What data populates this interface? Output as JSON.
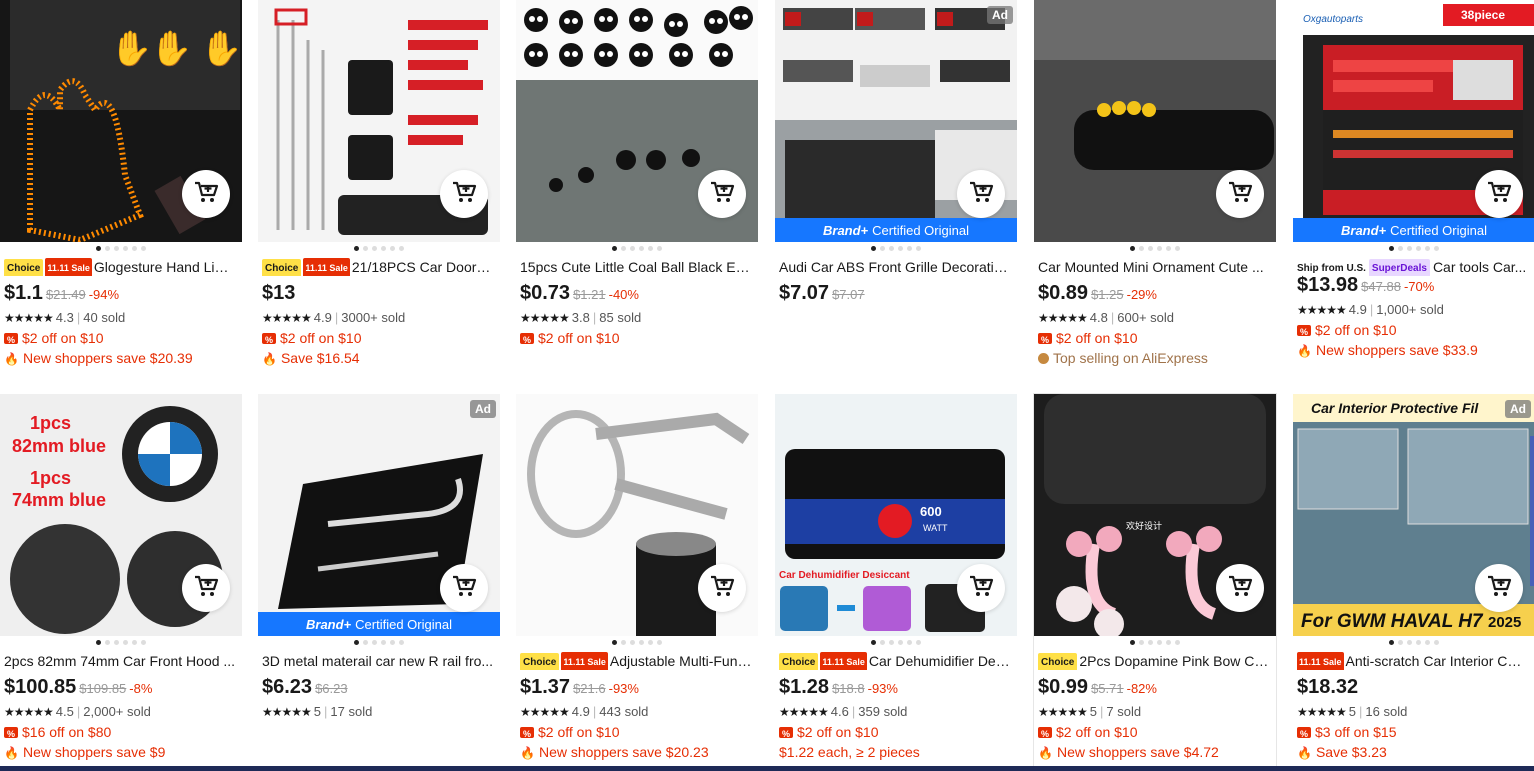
{
  "common": {
    "brand_plus": "Brand+",
    "certified": "Certified Original",
    "ad": "Ad"
  },
  "products": [
    {
      "col": 0,
      "row": 0,
      "tags": [
        "choice",
        "sale"
      ],
      "title": "Glogesture Hand Ligh...",
      "price": "$1.1",
      "orig": "$21.49",
      "disc": "-94%",
      "rating": "4.3",
      "sold": "40 sold",
      "promo1": "$2 off on $10",
      "promo2": "New shoppers save $20.39",
      "promo2_type": "fire",
      "img": "#1b1b1b",
      "accent": "#ff8a00",
      "brand": false,
      "ad": false
    },
    {
      "col": 1,
      "row": 0,
      "tags": [
        "choice",
        "sale"
      ],
      "title": "21/18PCS Car Door T...",
      "price": "$13",
      "orig": "",
      "disc": "",
      "rating": "4.9",
      "sold": "3000+ sold",
      "promo1": "$2 off on $10",
      "promo2": "Save $16.54",
      "promo2_type": "fire",
      "img": "#f4f4f4",
      "accent": "#d61f26",
      "brand": false,
      "ad": false
    },
    {
      "col": 2,
      "row": 0,
      "tags": [],
      "title": "15pcs Cute Little Coal Ball Black Elf...",
      "price": "$0.73",
      "orig": "$1.21",
      "disc": "-40%",
      "rating": "3.8",
      "sold": "85 sold",
      "promo1": "$2 off on $10",
      "promo2": "",
      "promo2_type": "",
      "img": "#6d7472",
      "accent": "#111111",
      "brand": false,
      "ad": false
    },
    {
      "col": 3,
      "row": 0,
      "tags": [],
      "title": "Audi Car ABS Front Grille Decoratio...",
      "price": "$7.07",
      "orig": "$7.07",
      "disc": "",
      "rating": "",
      "sold": "",
      "promo1": "",
      "promo2": "",
      "promo2_type": "",
      "img": "#d9d9d9",
      "accent": "#c11b1b",
      "brand": true,
      "ad": true
    },
    {
      "col": 4,
      "row": 0,
      "tags": [],
      "title": "Car Mounted Mini Ornament Cute ...",
      "price": "$0.89",
      "orig": "$1.25",
      "disc": "-29%",
      "rating": "4.8",
      "sold": "600+ sold",
      "promo1": "$2 off on $10",
      "promo2": "Top selling on AliExpress",
      "promo2_type": "top",
      "img": "#3b3b3b",
      "accent": "#f3c318",
      "brand": false,
      "ad": false
    },
    {
      "col": 5,
      "row": 0,
      "tags": [
        "us",
        "sd"
      ],
      "title": "Car tools Car...",
      "price": "$13.98",
      "orig": "$47.88",
      "disc": "-70%",
      "rating": "4.9",
      "sold": "1,000+ sold",
      "promo1": "$2 off on $10",
      "promo2": "New shoppers save $33.9",
      "promo2_type": "fire",
      "img": "#2b2b2b",
      "accent": "#e0242b",
      "brand": true,
      "ad": false,
      "badge": "38piece",
      "logo": "Oxgautoparts"
    },
    {
      "col": 0,
      "row": 1,
      "tags": [],
      "title": "2pcs 82mm 74mm Car Front Hood ...",
      "price": "$100.85",
      "orig": "$109.85",
      "disc": "-8%",
      "rating": "4.5",
      "sold": "2,000+ sold",
      "promo1": "$16 off on $80",
      "promo2": "New shoppers save $9",
      "promo2_type": "fire",
      "img": "#efefef",
      "accent": "#1e73be",
      "brand": false,
      "ad": false,
      "text1": "1pcs",
      "text2": "82mm blue",
      "text3": "1pcs",
      "text4": "74mm blue"
    },
    {
      "col": 1,
      "row": 1,
      "tags": [],
      "title": "3D metal materail car new R rail fro...",
      "price": "$6.23",
      "orig": "$6.23",
      "disc": "",
      "rating": "5",
      "sold": "17 sold",
      "promo1": "",
      "promo2": "",
      "promo2_type": "",
      "img": "#f2f2f2",
      "accent": "#0f0f0f",
      "brand": true,
      "ad": true
    },
    {
      "col": 2,
      "row": 1,
      "tags": [
        "choice",
        "sale"
      ],
      "title": "Adjustable Multi-Func...",
      "price": "$1.37",
      "orig": "$21.6",
      "disc": "-93%",
      "rating": "4.9",
      "sold": "443 sold",
      "promo1": "$2 off on $10",
      "promo2": "New shoppers save $20.23",
      "promo2_type": "fire",
      "img": "#f7f7f7",
      "accent": "#9a9a9a",
      "brand": false,
      "ad": false
    },
    {
      "col": 3,
      "row": 1,
      "tags": [
        "choice",
        "sale"
      ],
      "title": "Car Dehumidifier Desi...",
      "price": "$1.28",
      "orig": "$18.8",
      "disc": "-93%",
      "rating": "4.6",
      "sold": "359 sold",
      "promo1": "$2 off on $10",
      "promo2": "$1.22 each, ≥ 2 pieces",
      "promo2_type": "plain",
      "img": "#eef3f5",
      "accent": "#1b3d8f",
      "brand": false,
      "ad": false,
      "text1": "600",
      "text2": "WATT",
      "text3": "Car Dehumidifier Desiccant"
    },
    {
      "col": 4,
      "row": 1,
      "tags": [
        "choice"
      ],
      "title": "2Pcs Dopamine Pink Bow Ca...",
      "price": "$0.99",
      "orig": "$5.71",
      "disc": "-82%",
      "rating": "5",
      "sold": "7 sold",
      "promo1": "$2 off on $10",
      "promo2": "New shoppers save $4.72",
      "promo2_type": "fire",
      "img": "#1f1f1f",
      "accent": "#f2a9bd",
      "brand": false,
      "ad": false,
      "hover": true,
      "text1": "欢好设计"
    },
    {
      "col": 5,
      "row": 1,
      "tags": [
        "sale"
      ],
      "title": "Anti-scratch Car Interior Cen...",
      "price": "$18.32",
      "orig": "",
      "disc": "",
      "rating": "5",
      "sold": "16 sold",
      "promo1": "$3 off on $15",
      "promo2": "Save $3.23",
      "promo2_type": "fire",
      "img": "#5f7f8f",
      "accent": "#f6d04d",
      "brand": false,
      "ad": true,
      "text1": "Car Interior Protective Fil",
      "text2": "For GWM HAVAL H7",
      "text3": "2025"
    }
  ],
  "tag_labels": {
    "choice": "Choice",
    "sale": "11.11 Sale",
    "us": "Ship from U.S.",
    "sd": "SuperDeals"
  },
  "colors": {
    "price": "#191919",
    "discount": "#e62e04",
    "promo": "#e62e04",
    "brand_bar": "#1677ff"
  }
}
